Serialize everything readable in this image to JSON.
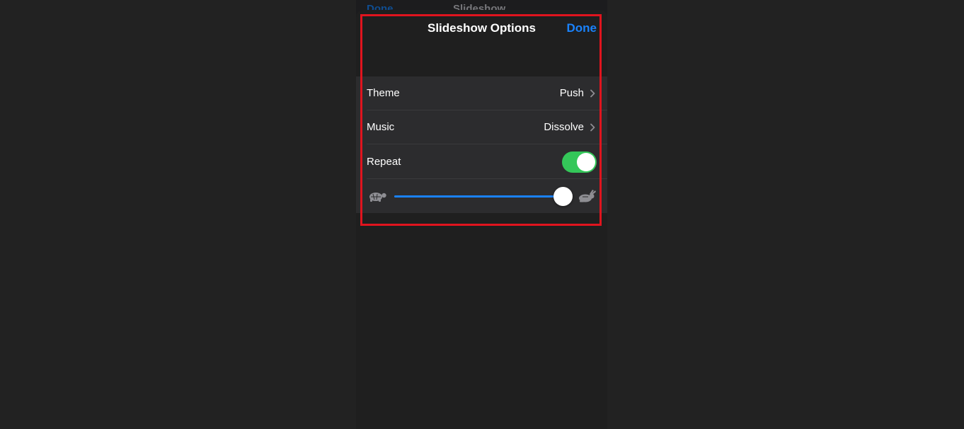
{
  "background_screen": {
    "done_label": "Done",
    "title": "Slideshow"
  },
  "sheet": {
    "title": "Slideshow Options",
    "done_label": "Done"
  },
  "options": {
    "theme": {
      "label": "Theme",
      "value": "Push"
    },
    "music": {
      "label": "Music",
      "value": "Dissolve"
    },
    "repeat": {
      "label": "Repeat",
      "on": true
    }
  },
  "speed_slider": {
    "min_icon": "turtle-icon",
    "max_icon": "rabbit-icon",
    "value": 0.95
  },
  "colors": {
    "accent": "#1a82fb",
    "toggle_on": "#34c759",
    "highlight": "#e0141e"
  }
}
